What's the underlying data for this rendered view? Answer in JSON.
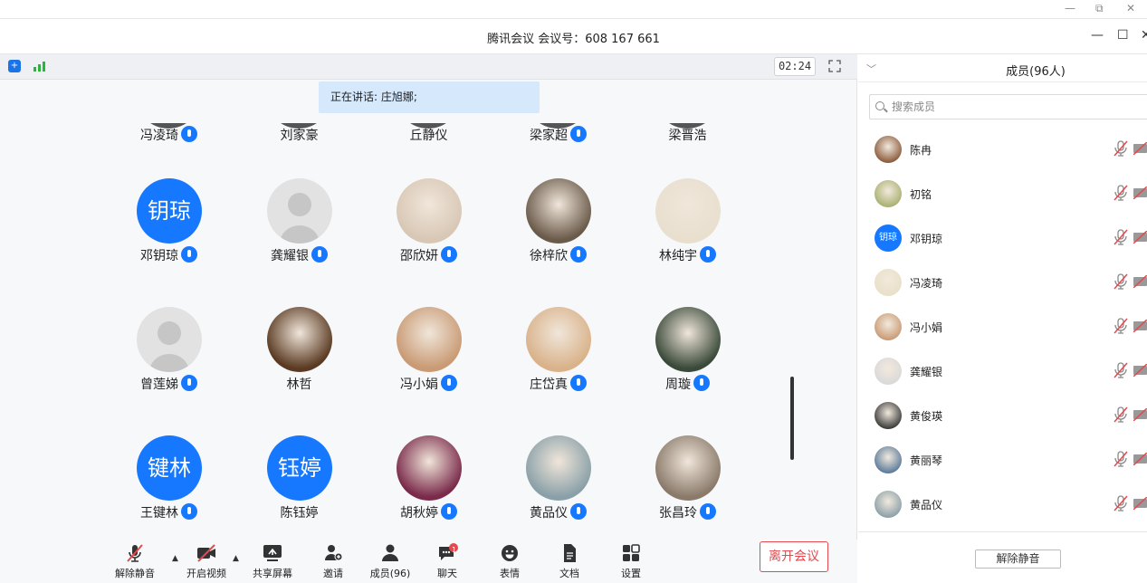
{
  "window": {
    "title": "腾讯会议 会议号：608 167 661",
    "outer_controls": [
      "—",
      "⧉",
      "✕"
    ],
    "controls": [
      "—",
      "☐",
      "✕"
    ]
  },
  "status": {
    "timer": "02:24",
    "speaking": "正在讲话: 庄旭娜;"
  },
  "grid": {
    "top_row": [
      {
        "name": "冯凌琦",
        "mic": true
      },
      {
        "name": "刘家豪",
        "mic": false
      },
      {
        "name": "丘静仪",
        "mic": false
      },
      {
        "name": "梁家超",
        "mic": true
      },
      {
        "name": "梁晋浩",
        "mic": false
      }
    ],
    "rows": [
      [
        {
          "name": "邓钥琼",
          "mic": true,
          "avatar_text": "钥琼",
          "avatar_type": "text"
        },
        {
          "name": "龚耀银",
          "mic": true,
          "avatar_type": "default"
        },
        {
          "name": "邵欣妍",
          "mic": true,
          "avatar_type": "photo",
          "color": "#d8c7b5"
        },
        {
          "name": "徐梓欣",
          "mic": true,
          "avatar_type": "photo",
          "color": "#6a5a4a"
        },
        {
          "name": "林纯宇",
          "mic": true,
          "avatar_type": "photo",
          "color": "#e9dfcf"
        }
      ],
      [
        {
          "name": "曾莲娣",
          "mic": true,
          "avatar_type": "default"
        },
        {
          "name": "林哲",
          "mic": false,
          "avatar_type": "photo",
          "color": "#5a3a22"
        },
        {
          "name": "冯小娟",
          "mic": true,
          "avatar_type": "photo",
          "color": "#c99a74"
        },
        {
          "name": "庄岱真",
          "mic": true,
          "avatar_type": "photo",
          "color": "#d9b28a"
        },
        {
          "name": "周璇",
          "mic": true,
          "avatar_type": "photo",
          "color": "#3a4a3a"
        }
      ],
      [
        {
          "name": "王键林",
          "mic": true,
          "avatar_text": "键林",
          "avatar_type": "text"
        },
        {
          "name": "陈钰婷",
          "mic": false,
          "avatar_text": "钰婷",
          "avatar_type": "text"
        },
        {
          "name": "胡秋婷",
          "mic": true,
          "avatar_type": "photo",
          "color": "#7a2a4a"
        },
        {
          "name": "黄品仪",
          "mic": true,
          "avatar_type": "photo",
          "color": "#8aa0a8"
        },
        {
          "name": "张昌玲",
          "mic": true,
          "avatar_type": "photo",
          "color": "#8a7a6a"
        }
      ]
    ]
  },
  "toolbar": {
    "items": [
      "解除静音",
      "开启视频",
      "共享屏幕",
      "邀请",
      "成员(96)",
      "聊天",
      "表情",
      "文档",
      "设置"
    ],
    "chat_badge": "1",
    "leave": "离开会议"
  },
  "sidebar": {
    "title": "成员(96人)",
    "search_placeholder": "搜索成员",
    "members": [
      {
        "name": "陈冉",
        "color": "#8a5a3a"
      },
      {
        "name": "初铭",
        "color": "#a8b070"
      },
      {
        "name": "邓钥琼",
        "avatar_text": "钥琼",
        "color": "#1677ff"
      },
      {
        "name": "冯凌琦",
        "color": "#e8e0c8"
      },
      {
        "name": "冯小娟",
        "color": "#c99a74"
      },
      {
        "name": "龚耀银",
        "color": "#d9d9d9"
      },
      {
        "name": "黄俊瑛",
        "color": "#3a3a3a"
      },
      {
        "name": "黄丽琴",
        "color": "#5a7a9a"
      },
      {
        "name": "黄品仪",
        "color": "#8aa0a8"
      }
    ],
    "unmute_all": "解除静音"
  },
  "colors": {
    "accent": "#1677ff",
    "leave": "#e5484d",
    "speaking_bg": "#d6e8fb",
    "signal": "#2eb33e"
  }
}
